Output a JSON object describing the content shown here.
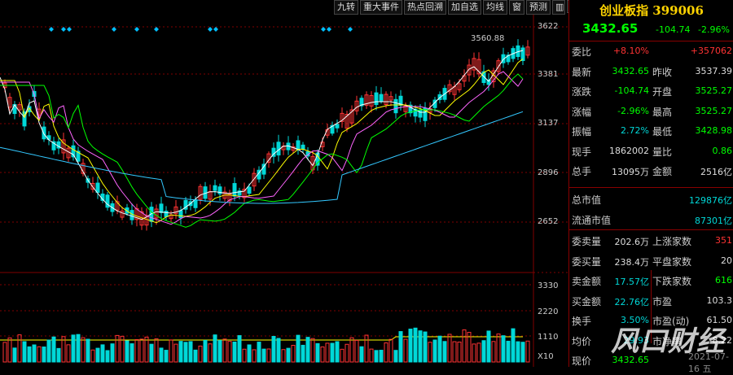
{
  "toolbar": {
    "buttons": [
      "九转",
      "重大事件",
      "热点回溯",
      "加自选",
      "均线",
      "窗",
      "预测"
    ],
    "more_icon": "grid-icon",
    "collapse_icon": "triangle-left-icon"
  },
  "chart": {
    "peak_label": "3560.88",
    "price_axis": [
      "3622",
      "3381",
      "3137",
      "2896",
      "2652"
    ],
    "volume_axis": [
      "3330",
      "2220",
      "1110",
      "X10"
    ]
  },
  "quote": {
    "title": "创业板指 399006",
    "price": "3432.65",
    "change": "-104.74",
    "change_pct": "-2.96%",
    "rows": [
      {
        "l": "委比",
        "v": "+8.10%",
        "vc": "r",
        "v2": "+357062",
        "v2c": "r",
        "l2": ""
      },
      {
        "l": "最新",
        "v": "3432.65",
        "vc": "g",
        "l2": "昨收",
        "v2": "3537.39",
        "v2c": "w"
      },
      {
        "l": "涨跌",
        "v": "-104.74",
        "vc": "g",
        "l2": "开盘",
        "v2": "3525.27",
        "v2c": "g"
      },
      {
        "l": "涨幅",
        "v": "-2.96%",
        "vc": "g",
        "l2": "最高",
        "v2": "3525.27",
        "v2c": "g"
      },
      {
        "l": "振幅",
        "v": "2.72%",
        "vc": "c",
        "l2": "最低",
        "v2": "3428.98",
        "v2c": "g"
      },
      {
        "l": "现手",
        "v": "1862002",
        "vc": "w",
        "l2": "量比",
        "v2": "0.86",
        "v2c": "g"
      },
      {
        "l": "总手",
        "v": "13095万",
        "vc": "w",
        "l2": "金额",
        "v2": "2516亿",
        "v2c": "w"
      }
    ],
    "total_mv_label": "总市值",
    "total_mv": "129876亿",
    "float_mv_label": "流通市值",
    "float_mv": "87301亿",
    "stats": [
      {
        "l": "委卖量",
        "v": "202.6万",
        "vc": "w",
        "l2": "上涨家数",
        "v2": "351",
        "v2c": "r"
      },
      {
        "l": "委买量",
        "v": "238.4万",
        "vc": "w",
        "l2": "平盘家数",
        "v2": "20",
        "v2c": "w"
      },
      {
        "l": "卖金额",
        "v": "17.57亿",
        "vc": "c",
        "l2": "下跌家数",
        "v2": "616",
        "v2c": "g"
      },
      {
        "l": "买金额",
        "v": "22.76亿",
        "vc": "c",
        "l2": "市盈",
        "v2": "103.3",
        "v2c": "w"
      },
      {
        "l": "换手",
        "v": "3.50%",
        "vc": "c",
        "l2": "市盈(动)",
        "v2": "61.50",
        "v2c": "w"
      },
      {
        "l": "均价",
        "v": "29.93",
        "vc": "c",
        "l2": "市净率",
        "v2": "8.22",
        "v2c": "w"
      },
      {
        "l": "现价",
        "v": "3432.65",
        "vc": "g",
        "l2": "",
        "v2": "",
        "v2c": "w"
      }
    ]
  },
  "watermark": "风口财经",
  "date": "2021-07-16 五",
  "colors": {
    "up": "#ff3333",
    "down": "#00d8d8",
    "ma5": "#ffffff",
    "ma10": "#ffff00",
    "ma20": "#ff66ff",
    "ma30": "#00ff00",
    "ma60": "#33c8ff",
    "marker": "#00bfff",
    "grid": "#800000"
  }
}
